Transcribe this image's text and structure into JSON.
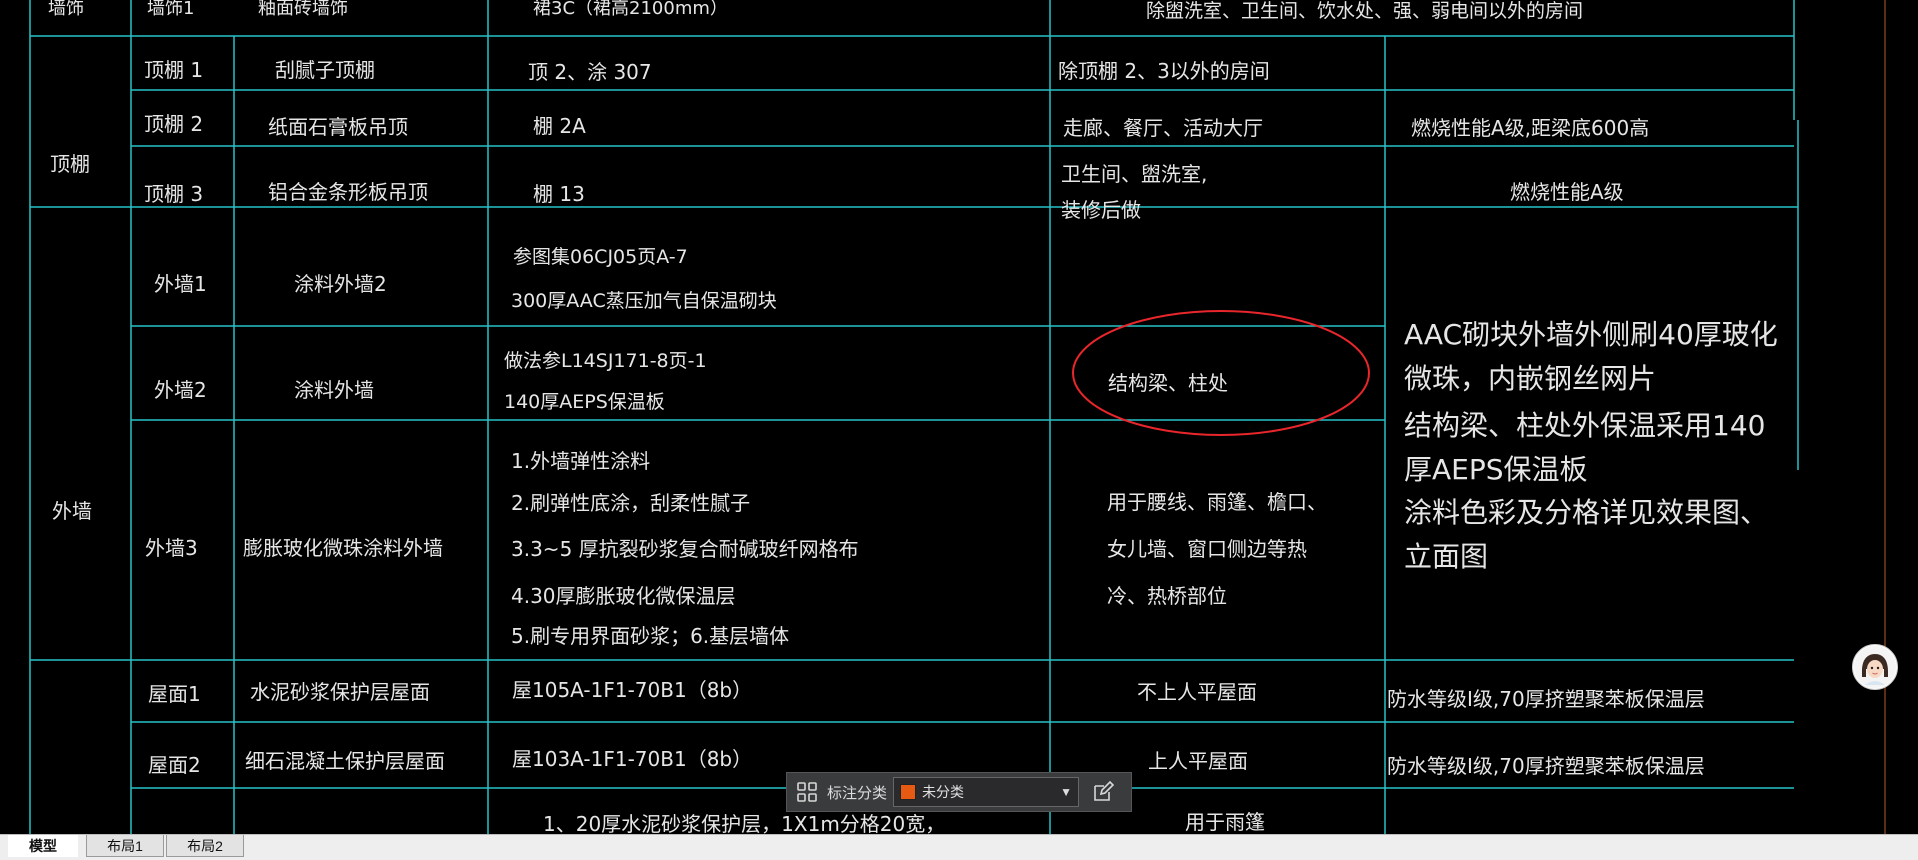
{
  "colors": {
    "grid": "#27c3c8",
    "highlight_ellipse": "#e8262b",
    "category_swatch": "#e55b13"
  },
  "rows": {
    "r0": {
      "category": "墙饰",
      "code": "墙饰1",
      "name": "釉面砖墙饰",
      "method": "裙3C（裙高2100mm）",
      "location": "除盥洗室、卫生间、饮水处、强、弱电间以外的房间"
    },
    "ceiling_group": "顶棚",
    "c1": {
      "code": "顶棚 1",
      "name": "刮腻子顶棚",
      "method": "顶 2、涂 307",
      "location": "除顶棚 2、3以外的房间",
      "note": ""
    },
    "c2": {
      "code": "顶棚 2",
      "name": "纸面石膏板吊顶",
      "method": "棚 2A",
      "location": "走廊、餐厅、活动大厅",
      "note": "燃烧性能A级,距梁底600高"
    },
    "c3": {
      "code": "顶棚 3",
      "name": "铝合金条形板吊顶",
      "method": "棚 13",
      "location_l1": "卫生间、盥洗室,",
      "location_l2": "装修后做",
      "note": "燃烧性能A级"
    },
    "wall_group": "外墙",
    "w1": {
      "code": "外墙1",
      "name": "涂料外墙2",
      "method_l1": "参图集06CJ05页A-7",
      "method_l2": "300厚AAC蒸压加气自保温砌块"
    },
    "w2": {
      "code": "外墙2",
      "name": "涂料外墙",
      "method_l1": "做法参L14SJ171-8页-1",
      "method_l2": "140厚AEPS保温板",
      "location": "结构梁、柱处"
    },
    "w3": {
      "code": "外墙3",
      "name": "膨胀玻化微珠涂料外墙",
      "m1": "1.外墙弹性涂料",
      "m2": "2.刷弹性底涂，刮柔性腻子",
      "m3": "3.3~5  厚抗裂砂浆复合耐碱玻纤网格布",
      "m4": "4.30厚膨胀玻化微保温层",
      "m5": "5.刷专用界面砂浆；6.基层墙体",
      "loc1": "用于腰线、雨篷、檐口、",
      "loc2": "女儿墙、窗口侧边等热",
      "loc3": "冷、热桥部位"
    },
    "wall_note_1": "AAC砌块外墙外侧刷40厚玻化微珠，内嵌钢丝网片",
    "wall_note_2": "结构梁、柱处外保温采用140厚AEPS保温板",
    "wall_note_3": "涂料色彩及分格详见效果图、立面图",
    "roof1": {
      "code": "屋面1",
      "name": "水泥砂浆保护层屋面",
      "method": "屋105A-1F1-70B1（8b）",
      "location": "不上人平屋面",
      "note": "防水等级Ⅰ级,70厚挤塑聚苯板保温层"
    },
    "roof2": {
      "code": "屋面2",
      "name": "细石混凝土保护层屋面",
      "method": "屋103A-1F1-70B1（8b）",
      "location": "上人平屋面",
      "note": "防水等级Ⅰ级,70厚挤塑聚苯板保温层"
    },
    "roof3": {
      "method": "1、20厚水泥砂浆保护层，1X1m分格20宽，",
      "location": "用于雨篷"
    }
  },
  "toolbar": {
    "label": "标注分类",
    "selected": "未分类",
    "grid_icon": "grid-icon",
    "edit_icon": "edit-icon"
  },
  "tabs": [
    "模型",
    "布局1",
    "布局2"
  ]
}
